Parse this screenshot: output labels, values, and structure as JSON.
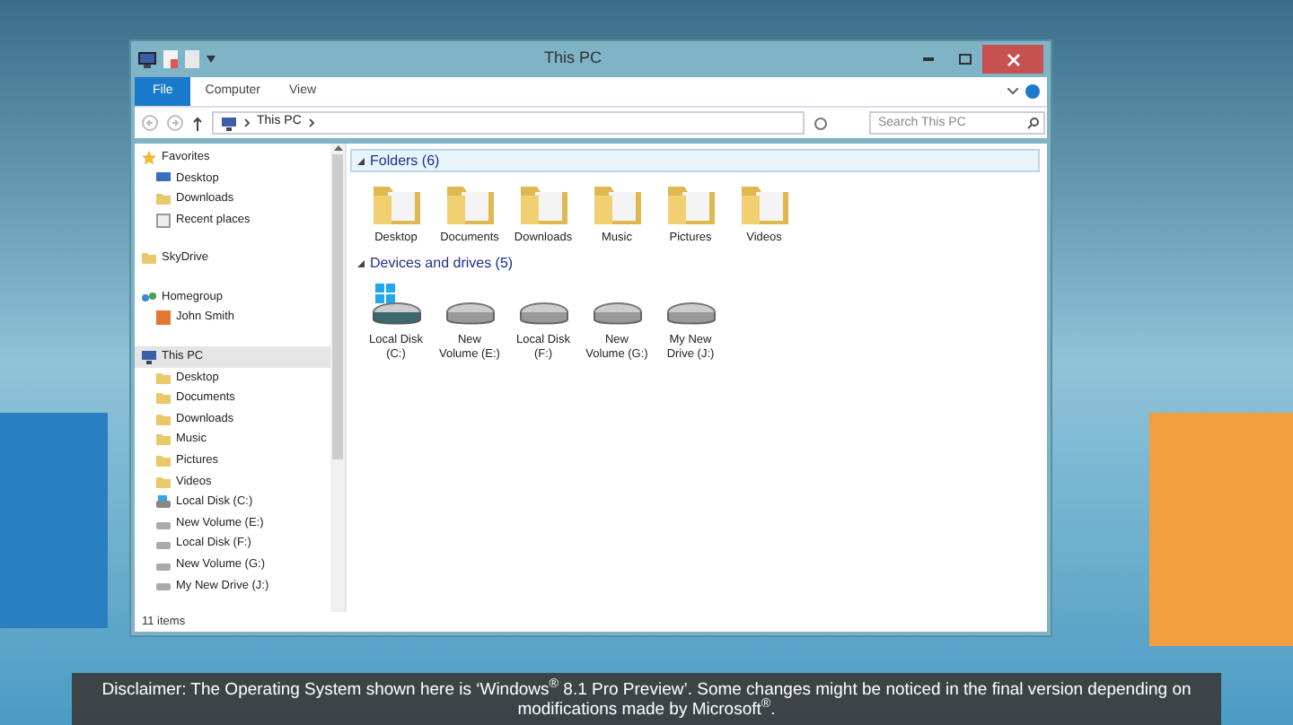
{
  "window": {
    "title": "This PC"
  },
  "ribbon_tabs": [
    {
      "label": "File",
      "selected": true
    },
    {
      "label": "Computer",
      "selected": false
    },
    {
      "label": "View",
      "selected": false
    }
  ],
  "address_bar": {
    "path": "This PC"
  },
  "search": {
    "placeholder": "Search This PC"
  },
  "nav_groups": [
    {
      "items": [
        {
          "label": "Favorites",
          "kind": "star",
          "selected": false,
          "children": [
            {
              "label": "Desktop",
              "kind": "desktop",
              "selected": false
            },
            {
              "label": "Downloads",
              "kind": "folder",
              "selected": false
            },
            {
              "label": "Recent places",
              "kind": "recent",
              "selected": false
            }
          ]
        }
      ]
    },
    {
      "items": [
        {
          "label": "SkyDrive",
          "kind": "folder",
          "selected": false
        }
      ]
    },
    {
      "items": [
        {
          "label": "Homegroup",
          "kind": "homegroup",
          "selected": false,
          "children": [
            {
              "label": "John Smith",
              "kind": "user",
              "selected": false
            }
          ]
        }
      ]
    },
    {
      "items": [
        {
          "label": "This PC",
          "kind": "pc",
          "selected": true,
          "children": [
            {
              "label": "Desktop",
              "kind": "folder",
              "selected": false
            },
            {
              "label": "Documents",
              "kind": "folder",
              "selected": false
            },
            {
              "label": "Downloads",
              "kind": "folder",
              "selected": false
            },
            {
              "label": "Music",
              "kind": "folder",
              "selected": false
            },
            {
              "label": "Pictures",
              "kind": "folder",
              "selected": false
            },
            {
              "label": "Videos",
              "kind": "folder",
              "selected": false
            },
            {
              "label": "Local Disk (C:)",
              "kind": "system-disk",
              "selected": false
            },
            {
              "label": "New Volume (E:)",
              "kind": "disk",
              "selected": false
            },
            {
              "label": "Local Disk (F:)",
              "kind": "disk",
              "selected": false
            },
            {
              "label": "New Volume (G:)",
              "kind": "disk",
              "selected": false
            },
            {
              "label": "My New Drive (J:)",
              "kind": "disk",
              "selected": false
            }
          ]
        }
      ]
    }
  ],
  "sections": [
    {
      "title": "Folders (6)",
      "expanded": true,
      "hovered": true,
      "items": [
        {
          "label": "Desktop",
          "kind": "folder"
        },
        {
          "label": "Documents",
          "kind": "folder"
        },
        {
          "label": "Downloads",
          "kind": "folder"
        },
        {
          "label": "Music",
          "kind": "folder"
        },
        {
          "label": "Pictures",
          "kind": "folder"
        },
        {
          "label": "Videos",
          "kind": "folder"
        }
      ]
    },
    {
      "title": "Devices and drives (5)",
      "expanded": true,
      "hovered": false,
      "items": [
        {
          "label": "Local Disk (C:)",
          "kind": "system-disk"
        },
        {
          "label": "New Volume (E:)",
          "kind": "disk"
        },
        {
          "label": "Local Disk (F:)",
          "kind": "disk"
        },
        {
          "label": "New Volume (G:)",
          "kind": "disk"
        },
        {
          "label": "My New Drive (J:)",
          "kind": "disk"
        }
      ]
    }
  ],
  "status_bar": {
    "text": "11 items"
  },
  "caption": {
    "text": "Disclaimer: The Operating System shown here is ‘Windows$^{®}$ 8.1 Pro Preview’. Some changes might be noticed in the final version depending on modifications made by Microsoft$^{®}$."
  }
}
